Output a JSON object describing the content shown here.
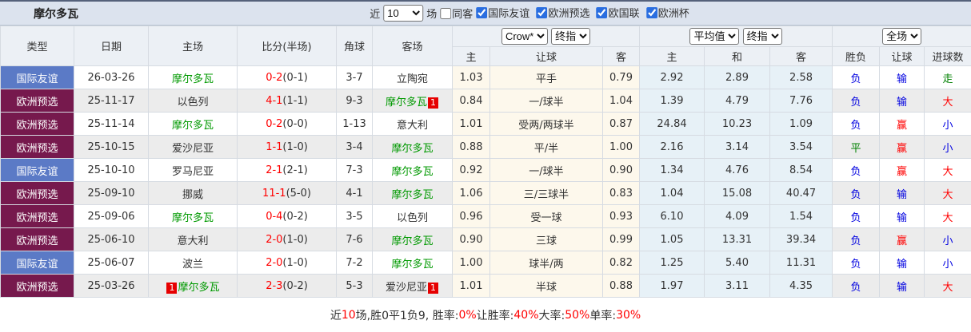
{
  "title": "摩尔多瓦",
  "topbar": {
    "near_label": "近",
    "match_count": "10",
    "games_label": "场",
    "same_away": {
      "label": "同客",
      "checked": false
    },
    "filters": [
      {
        "label": "国际友谊",
        "checked": true
      },
      {
        "label": "欧洲预选",
        "checked": true
      },
      {
        "label": "欧国联",
        "checked": true
      },
      {
        "label": "欧洲杯",
        "checked": true
      }
    ]
  },
  "header": {
    "cols": {
      "type": "类型",
      "date": "日期",
      "home": "主场",
      "score": "比分(半场)",
      "corner": "角球",
      "away": "客场"
    },
    "selects": {
      "bookmaker": "Crow*",
      "ah_time": "终指",
      "eu_type": "平均值",
      "eu_time": "终指",
      "scope": "全场"
    },
    "sub": [
      "主",
      "让球",
      "客",
      "主",
      "和",
      "客",
      "胜负",
      "让球",
      "进球数"
    ]
  },
  "colors": {
    "friendly_badge": "#5b7ac6",
    "qualifier_badge": "#76194d",
    "team_highlight": "#009900",
    "loss_blue": "#0000e0",
    "win_red": "#ff0000",
    "draw_green": "#008000"
  },
  "rows": [
    {
      "type": {
        "t": "国际友谊",
        "bg": "#5b7ac6"
      },
      "date": "26-03-26",
      "home_badge": "",
      "home": {
        "t": "摩尔多瓦",
        "c": "#009900"
      },
      "score": "0-2",
      "half": "(0-1)",
      "corner": "3-7",
      "away": {
        "t": "立陶宛",
        "c": "#333333"
      },
      "away_badge": "",
      "ah_home": "1.03",
      "handicap": "平手",
      "ah_away": "0.79",
      "eu_home": "2.92",
      "eu_draw": "2.89",
      "eu_away": "2.58",
      "wdl": {
        "t": "负",
        "c": "#0000e0"
      },
      "ah_result": {
        "t": "输",
        "c": "#0000e0"
      },
      "ou_result": {
        "t": "走",
        "c": "#008000"
      }
    },
    {
      "type": {
        "t": "欧洲预选",
        "bg": "#76194d"
      },
      "date": "25-11-17",
      "home_badge": "",
      "home": {
        "t": "以色列",
        "c": "#333333"
      },
      "score": "4-1",
      "half": "(1-1)",
      "corner": "9-3",
      "away": {
        "t": "摩尔多瓦",
        "c": "#009900"
      },
      "away_badge": "1",
      "ah_home": "0.84",
      "handicap": "一/球半",
      "ah_away": "1.04",
      "eu_home": "1.39",
      "eu_draw": "4.79",
      "eu_away": "7.76",
      "wdl": {
        "t": "负",
        "c": "#0000e0"
      },
      "ah_result": {
        "t": "输",
        "c": "#0000e0"
      },
      "ou_result": {
        "t": "大",
        "c": "#ff0000"
      }
    },
    {
      "type": {
        "t": "欧洲预选",
        "bg": "#76194d"
      },
      "date": "25-11-14",
      "home_badge": "",
      "home": {
        "t": "摩尔多瓦",
        "c": "#009900"
      },
      "score": "0-2",
      "half": "(0-0)",
      "corner": "1-13",
      "away": {
        "t": "意大利",
        "c": "#333333"
      },
      "away_badge": "",
      "ah_home": "1.01",
      "handicap": "受两/两球半",
      "ah_away": "0.87",
      "eu_home": "24.84",
      "eu_draw": "10.23",
      "eu_away": "1.09",
      "wdl": {
        "t": "负",
        "c": "#0000e0"
      },
      "ah_result": {
        "t": "赢",
        "c": "#ff0000"
      },
      "ou_result": {
        "t": "小",
        "c": "#0000e0"
      }
    },
    {
      "type": {
        "t": "欧洲预选",
        "bg": "#76194d"
      },
      "date": "25-10-15",
      "home_badge": "",
      "home": {
        "t": "爱沙尼亚",
        "c": "#333333"
      },
      "score": "1-1",
      "half": "(1-0)",
      "corner": "3-4",
      "away": {
        "t": "摩尔多瓦",
        "c": "#009900"
      },
      "away_badge": "",
      "ah_home": "0.88",
      "handicap": "平/半",
      "ah_away": "1.00",
      "eu_home": "2.16",
      "eu_draw": "3.14",
      "eu_away": "3.54",
      "wdl": {
        "t": "平",
        "c": "#008000"
      },
      "ah_result": {
        "t": "赢",
        "c": "#ff0000"
      },
      "ou_result": {
        "t": "小",
        "c": "#0000e0"
      }
    },
    {
      "type": {
        "t": "国际友谊",
        "bg": "#5b7ac6"
      },
      "date": "25-10-10",
      "home_badge": "",
      "home": {
        "t": "罗马尼亚",
        "c": "#333333"
      },
      "score": "2-1",
      "half": "(2-1)",
      "corner": "7-3",
      "away": {
        "t": "摩尔多瓦",
        "c": "#009900"
      },
      "away_badge": "",
      "ah_home": "0.92",
      "handicap": "一/球半",
      "ah_away": "0.90",
      "eu_home": "1.34",
      "eu_draw": "4.76",
      "eu_away": "8.54",
      "wdl": {
        "t": "负",
        "c": "#0000e0"
      },
      "ah_result": {
        "t": "赢",
        "c": "#ff0000"
      },
      "ou_result": {
        "t": "大",
        "c": "#ff0000"
      }
    },
    {
      "type": {
        "t": "欧洲预选",
        "bg": "#76194d"
      },
      "date": "25-09-10",
      "home_badge": "",
      "home": {
        "t": "挪威",
        "c": "#333333"
      },
      "score": "11-1",
      "half": "(5-0)",
      "corner": "4-1",
      "away": {
        "t": "摩尔多瓦",
        "c": "#009900"
      },
      "away_badge": "",
      "ah_home": "1.06",
      "handicap": "三/三球半",
      "ah_away": "0.83",
      "eu_home": "1.04",
      "eu_draw": "15.08",
      "eu_away": "40.47",
      "wdl": {
        "t": "负",
        "c": "#0000e0"
      },
      "ah_result": {
        "t": "输",
        "c": "#0000e0"
      },
      "ou_result": {
        "t": "大",
        "c": "#ff0000"
      }
    },
    {
      "type": {
        "t": "欧洲预选",
        "bg": "#76194d"
      },
      "date": "25-09-06",
      "home_badge": "",
      "home": {
        "t": "摩尔多瓦",
        "c": "#009900"
      },
      "score": "0-4",
      "half": "(0-2)",
      "corner": "3-5",
      "away": {
        "t": "以色列",
        "c": "#333333"
      },
      "away_badge": "",
      "ah_home": "0.96",
      "handicap": "受一球",
      "ah_away": "0.93",
      "eu_home": "6.10",
      "eu_draw": "4.09",
      "eu_away": "1.54",
      "wdl": {
        "t": "负",
        "c": "#0000e0"
      },
      "ah_result": {
        "t": "输",
        "c": "#0000e0"
      },
      "ou_result": {
        "t": "大",
        "c": "#ff0000"
      }
    },
    {
      "type": {
        "t": "欧洲预选",
        "bg": "#76194d"
      },
      "date": "25-06-10",
      "home_badge": "",
      "home": {
        "t": "意大利",
        "c": "#333333"
      },
      "score": "2-0",
      "half": "(1-0)",
      "corner": "7-6",
      "away": {
        "t": "摩尔多瓦",
        "c": "#009900"
      },
      "away_badge": "",
      "ah_home": "0.90",
      "handicap": "三球",
      "ah_away": "0.99",
      "eu_home": "1.05",
      "eu_draw": "13.31",
      "eu_away": "39.34",
      "wdl": {
        "t": "负",
        "c": "#0000e0"
      },
      "ah_result": {
        "t": "赢",
        "c": "#ff0000"
      },
      "ou_result": {
        "t": "小",
        "c": "#0000e0"
      }
    },
    {
      "type": {
        "t": "国际友谊",
        "bg": "#5b7ac6"
      },
      "date": "25-06-07",
      "home_badge": "",
      "home": {
        "t": "波兰",
        "c": "#333333"
      },
      "score": "2-0",
      "half": "(1-0)",
      "corner": "7-2",
      "away": {
        "t": "摩尔多瓦",
        "c": "#009900"
      },
      "away_badge": "",
      "ah_home": "1.00",
      "handicap": "球半/两",
      "ah_away": "0.82",
      "eu_home": "1.25",
      "eu_draw": "5.40",
      "eu_away": "11.31",
      "wdl": {
        "t": "负",
        "c": "#0000e0"
      },
      "ah_result": {
        "t": "输",
        "c": "#0000e0"
      },
      "ou_result": {
        "t": "小",
        "c": "#0000e0"
      }
    },
    {
      "type": {
        "t": "欧洲预选",
        "bg": "#76194d"
      },
      "date": "25-03-26",
      "home_badge": "1",
      "home": {
        "t": "摩尔多瓦",
        "c": "#009900"
      },
      "score": "2-3",
      "half": "(0-2)",
      "corner": "5-3",
      "away": {
        "t": "爱沙尼亚",
        "c": "#333333"
      },
      "away_badge": "1",
      "ah_home": "1.01",
      "handicap": "半球",
      "ah_away": "0.88",
      "eu_home": "1.97",
      "eu_draw": "3.11",
      "eu_away": "4.35",
      "wdl": {
        "t": "负",
        "c": "#0000e0"
      },
      "ah_result": {
        "t": "输",
        "c": "#0000e0"
      },
      "ou_result": {
        "t": "大",
        "c": "#ff0000"
      }
    }
  ],
  "summary": {
    "segments": [
      {
        "t": "近",
        "c": "#333333"
      },
      {
        "t": "10",
        "c": "#ff0000"
      },
      {
        "t": "场,胜0平1负9, 胜率:",
        "c": "#333333"
      },
      {
        "t": "0%",
        "c": "#ff0000"
      },
      {
        "t": " 让胜率:",
        "c": "#333333"
      },
      {
        "t": "40%",
        "c": "#ff0000"
      },
      {
        "t": " 大率:",
        "c": "#333333"
      },
      {
        "t": "50%",
        "c": "#ff0000"
      },
      {
        "t": " 单率:",
        "c": "#333333"
      },
      {
        "t": "30%",
        "c": "#ff0000"
      }
    ]
  }
}
